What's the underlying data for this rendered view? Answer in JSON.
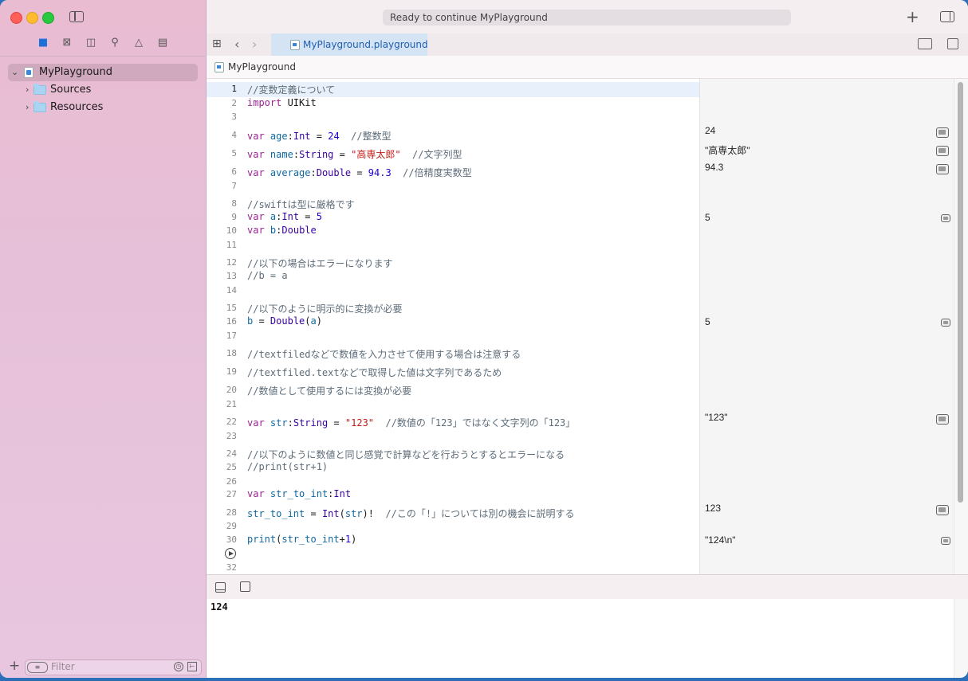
{
  "toolbar": {
    "status": "Ready to continue MyPlayground"
  },
  "tab": {
    "label": "MyPlayground.playground"
  },
  "jumpbar": {
    "label": "MyPlayground"
  },
  "navigator": {
    "items": [
      {
        "label": "MyPlayground",
        "icon": "playground-icon"
      },
      {
        "label": "Sources",
        "icon": "folder-icon"
      },
      {
        "label": "Resources",
        "icon": "folder-icon"
      }
    ],
    "filter_placeholder": "Filter"
  },
  "code": {
    "numbers": [
      "1",
      "2",
      "3",
      "4",
      "5",
      "6",
      "7",
      "8",
      "9",
      "10",
      "11",
      "12",
      "13",
      "14",
      "15",
      "16",
      "17",
      "18",
      "19",
      "20",
      "21",
      "22",
      "23",
      "24",
      "25",
      "26",
      "27",
      "28",
      "29",
      "30",
      "32"
    ],
    "lines": [
      "//変数定義について",
      "import UIKit",
      "",
      "var age:Int = 24  //整数型",
      "var name:String = \"高専太郎\"  //文字列型",
      "var average:Double = 94.3  //倍精度実数型",
      "",
      "//swiftは型に厳格です",
      "var a:Int = 5",
      "var b:Double",
      "",
      "//以下の場合はエラーになります",
      "//b = a",
      "",
      "//以下のように明示的に変換が必要",
      "b = Double(a)",
      "",
      "//textfiledなどで数値を入力させて使用する場合は注意する",
      "//textfiled.textなどで取得した値は文字列であるため",
      "//数値として使用するには変換が必要",
      "",
      "var str:String = \"123\"  //数値の「123」ではなく文字列の「123」",
      "",
      "//以下のように数値と同じ感覚で計算などを行おうとするとエラーになる",
      "//print(str+1)",
      "",
      "var str_to_int:Int",
      "str_to_int = Int(str)!  //この「!」については別の機会に説明する",
      "",
      "print(str_to_int+1)",
      ""
    ]
  },
  "results": [
    {
      "line": "4",
      "value": "24"
    },
    {
      "line": "5",
      "value": "\"高専太郎\""
    },
    {
      "line": "6",
      "value": "94.3"
    },
    {
      "line": "9",
      "value": "5"
    },
    {
      "line": "16",
      "value": "5"
    },
    {
      "line": "22",
      "value": "\"123\""
    },
    {
      "line": "28",
      "value": "123"
    },
    {
      "line": "30",
      "value": "\"124\\n\""
    }
  ],
  "console": {
    "output": "124"
  },
  "colors": {
    "keyword": "#9b2393",
    "type": "#3900a0",
    "number": "#1c00cf",
    "string": "#c41a16",
    "comment": "#5d6c79",
    "tab_active": "#d5e4f4"
  }
}
